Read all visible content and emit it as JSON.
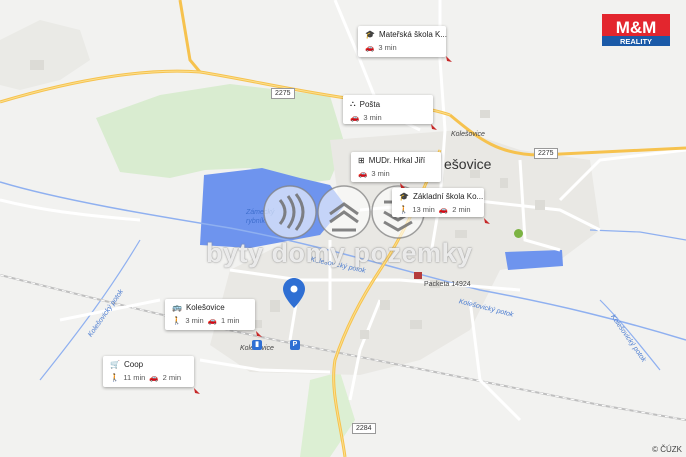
{
  "map": {
    "town_label": "ešovice",
    "copyright": "© ČÚZK",
    "watermark": "byty domy pozemky",
    "brand": {
      "top": "M&M",
      "bottom": "REALITY",
      "color": "#e3262e"
    },
    "colors": {
      "pin": "#2f6fd3",
      "water": "#6e94ee",
      "green": "#d8ebcf",
      "road_major": "#f6c24e",
      "background": "#f2f2f0"
    }
  },
  "roads": [
    {
      "number": "2275"
    },
    {
      "number": "2275"
    },
    {
      "number": "2284"
    }
  ],
  "labels": {
    "kolesovice_top": "Kolešovice",
    "station": "Kolešovice",
    "packeta": "Packeta 14924",
    "stream_1": "Kolešovický potok",
    "stream_2": "Kolešovický potok",
    "stream_3": "Kolešovický potok",
    "stream_4": "Kolešovický potok",
    "pond": "Zámecký rybník"
  },
  "pois": [
    {
      "name": "Mateřská škola K...",
      "icon": "school-icon",
      "walk": "",
      "drive": "3 min"
    },
    {
      "name": "Pošta",
      "icon": "post-icon",
      "walk": "",
      "drive": "3 min"
    },
    {
      "name": "MUDr. Hrkal Jiří",
      "icon": "medical-icon",
      "walk": "",
      "drive": "3 min"
    },
    {
      "name": "Základní škola Ko...",
      "icon": "school-icon",
      "walk": "13 min",
      "drive": "2 min"
    },
    {
      "name": "Kolešovice",
      "icon": "bus-icon",
      "walk": "3 min",
      "drive": "1 min"
    },
    {
      "name": "Coop",
      "icon": "cart-icon",
      "walk": "11 min",
      "drive": "2 min"
    }
  ]
}
